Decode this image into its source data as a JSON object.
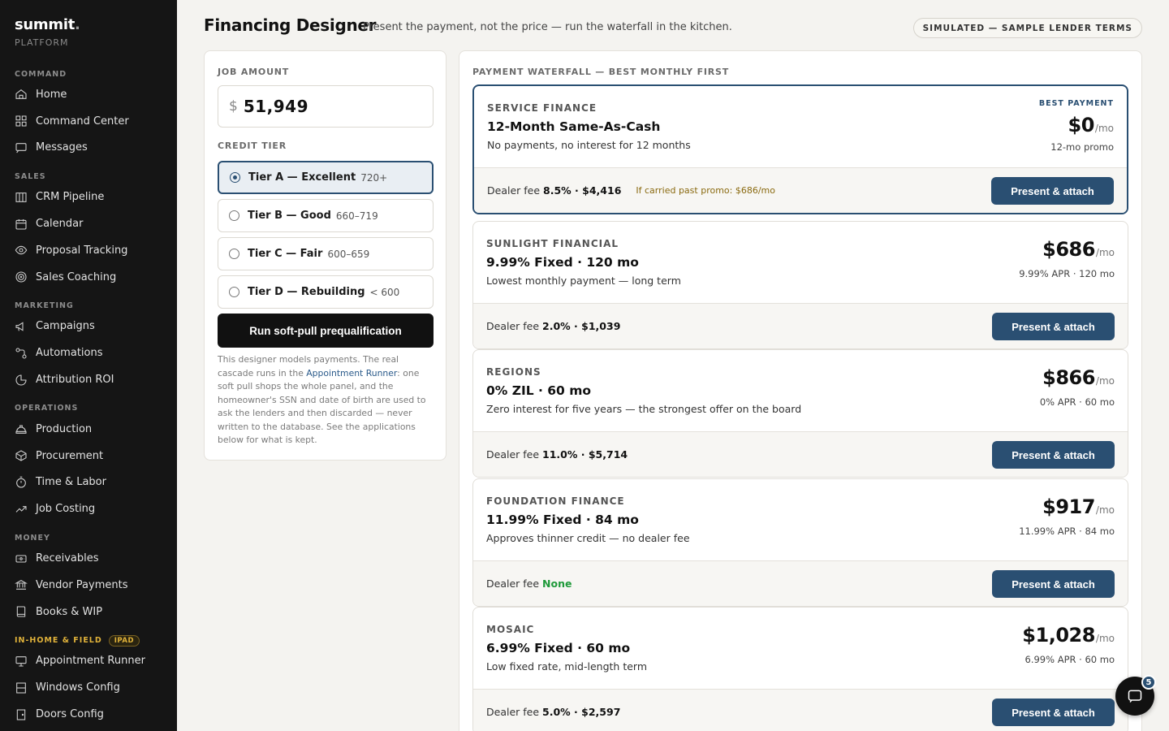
{
  "brand": {
    "name": "summit",
    "sub": "PLATFORM"
  },
  "sidebar": {
    "sections": [
      {
        "title": "COMMAND",
        "items": [
          {
            "label": "Home",
            "icon": "home-icon"
          },
          {
            "label": "Command Center",
            "icon": "grid-icon"
          },
          {
            "label": "Messages",
            "icon": "message-icon"
          }
        ]
      },
      {
        "title": "SALES",
        "items": [
          {
            "label": "CRM Pipeline",
            "icon": "columns-icon"
          },
          {
            "label": "Calendar",
            "icon": "calendar-icon"
          },
          {
            "label": "Proposal Tracking",
            "icon": "eye-icon"
          },
          {
            "label": "Sales Coaching",
            "icon": "target-icon"
          }
        ]
      },
      {
        "title": "MARKETING",
        "items": [
          {
            "label": "Campaigns",
            "icon": "megaphone-icon"
          },
          {
            "label": "Automations",
            "icon": "automation-icon"
          },
          {
            "label": "Attribution ROI",
            "icon": "pie-icon"
          }
        ]
      },
      {
        "title": "OPERATIONS",
        "items": [
          {
            "label": "Production",
            "icon": "hardhat-icon"
          },
          {
            "label": "Procurement",
            "icon": "box-icon"
          },
          {
            "label": "Time & Labor",
            "icon": "stopwatch-icon"
          },
          {
            "label": "Job Costing",
            "icon": "trend-icon"
          }
        ]
      },
      {
        "title": "MONEY",
        "items": [
          {
            "label": "Receivables",
            "icon": "receipt-icon"
          },
          {
            "label": "Vendor Payments",
            "icon": "bank-icon"
          },
          {
            "label": "Books & WIP",
            "icon": "book-icon"
          }
        ]
      },
      {
        "title": "IN-HOME & FIELD",
        "badge": "IPAD",
        "items": [
          {
            "label": "Appointment Runner",
            "icon": "presentation-icon"
          },
          {
            "label": "Windows Config",
            "icon": "window-icon"
          },
          {
            "label": "Doors Config",
            "icon": "door-icon"
          }
        ]
      }
    ]
  },
  "header": {
    "title": "Financing Designer",
    "subtitle": "Present the payment, not the price — run the waterfall in the kitchen.",
    "badge": "SIMULATED — SAMPLE LENDER TERMS"
  },
  "left": {
    "job_label": "JOB AMOUNT",
    "currency": "$",
    "amount": "51,949",
    "tier_label": "CREDIT TIER",
    "tiers": [
      {
        "name": "Tier A — Excellent",
        "range": "720+",
        "selected": true
      },
      {
        "name": "Tier B — Good",
        "range": "660–719",
        "selected": false
      },
      {
        "name": "Tier C — Fair",
        "range": "600–659",
        "selected": false
      },
      {
        "name": "Tier D — Rebuilding",
        "range": "< 600",
        "selected": false
      }
    ],
    "run_button": "Run soft-pull prequalification",
    "note_pre": "This designer models payments. The real cascade runs in the ",
    "note_link": "Appointment Runner",
    "note_post": ": one soft pull shops the whole panel, and the homeowner's SSN and date of birth are used to ask the lenders and then discarded — never written to the database. See the applications below for what is kept."
  },
  "waterfall": {
    "label": "PAYMENT WATERFALL — BEST MONTHLY FIRST",
    "present_label": "Present & attach",
    "best_tag": "BEST PAYMENT",
    "fee_prefix": "Dealer fee",
    "offers": [
      {
        "lender": "SERVICE FINANCE",
        "product": "12-Month Same-As-Cash",
        "desc": "No payments, no interest for 12 months",
        "payment": "$0",
        "unit": "/mo",
        "terms": "12-mo promo",
        "fee": "8.5% · $4,416",
        "promo_note": "If carried past promo: $686/mo",
        "best": true
      },
      {
        "lender": "SUNLIGHT FINANCIAL",
        "product": "9.99% Fixed · 120 mo",
        "desc": "Lowest monthly payment — long term",
        "payment": "$686",
        "unit": "/mo",
        "terms": "9.99% APR · 120 mo",
        "fee": "2.0% · $1,039"
      },
      {
        "lender": "REGIONS",
        "product": "0% ZIL · 60 mo",
        "desc": "Zero interest for five years — the strongest offer on the board",
        "payment": "$866",
        "unit": "/mo",
        "terms": "0% APR · 60 mo",
        "fee": "11.0% · $5,714"
      },
      {
        "lender": "FOUNDATION FINANCE",
        "product": "11.99% Fixed · 84 mo",
        "desc": "Approves thinner credit — no dealer fee",
        "payment": "$917",
        "unit": "/mo",
        "terms": "11.99% APR · 84 mo",
        "fee": "None",
        "fee_none": true
      },
      {
        "lender": "MOSAIC",
        "product": "6.99% Fixed · 60 mo",
        "desc": "Low fixed rate, mid-length term",
        "payment": "$1,028",
        "unit": "/mo",
        "terms": "6.99% APR · 60 mo",
        "fee": "5.0% · $2,597"
      }
    ]
  },
  "chat": {
    "count": "5",
    "icon": "chat-icon"
  },
  "colors": {
    "accent": "#2a4f72",
    "sidebar": "#151515",
    "section_accent": "#e0b23a",
    "fee_none": "#1f9a3a"
  }
}
